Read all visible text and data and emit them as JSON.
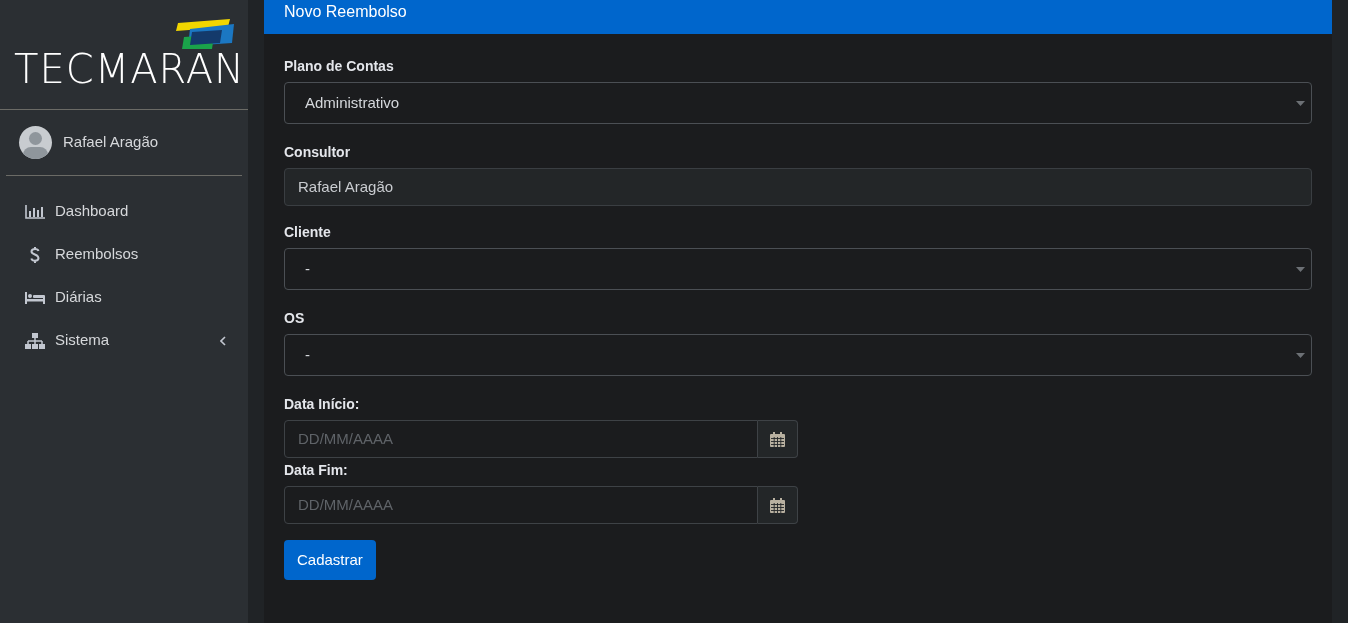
{
  "sidebar": {
    "logo_text": "TECMARAN",
    "user": {
      "name": "Rafael Aragão"
    },
    "items": [
      {
        "label": "Dashboard",
        "kind": "chart",
        "expandable": false
      },
      {
        "label": "Reembolsos",
        "kind": "dollar",
        "expandable": false
      },
      {
        "label": "Diárias",
        "kind": "bed",
        "expandable": false
      },
      {
        "label": "Sistema",
        "kind": "sitemap",
        "expandable": true
      }
    ]
  },
  "card": {
    "title": "Novo Reembolso",
    "fields": [
      {
        "kind": "select",
        "label": "Plano de Contas",
        "value": "Administrativo"
      },
      {
        "kind": "readonly",
        "label": "Consultor",
        "value": "Rafael Aragão"
      },
      {
        "kind": "select",
        "label": "Cliente",
        "value": "-"
      },
      {
        "kind": "select",
        "label": "OS",
        "value": "-"
      },
      {
        "kind": "date",
        "label": "Data Início:",
        "placeholder": "DD/MM/AAAA"
      },
      {
        "kind": "date",
        "label": "Data Fim:",
        "placeholder": "DD/MM/AAAA"
      }
    ],
    "submit": "Cadastrar"
  }
}
